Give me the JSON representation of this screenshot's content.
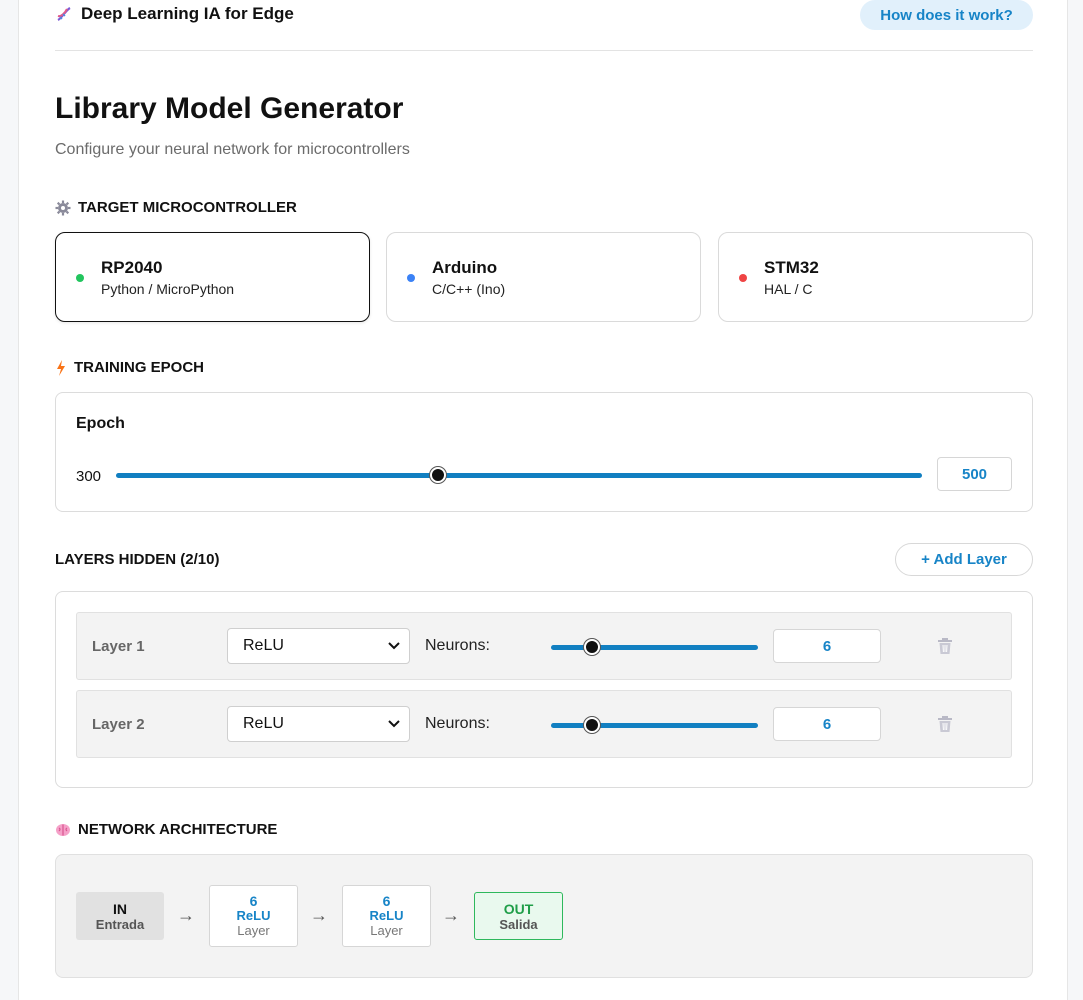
{
  "header": {
    "brand_title": "Deep Learning IA for Edge",
    "brand_icon": "dna-icon",
    "help_button": "How does it work?"
  },
  "main": {
    "title": "Library Model Generator",
    "subtitle": "Configure your neural network for microcontrollers"
  },
  "target": {
    "section_label": "TARGET MICROCONTROLLER",
    "section_icon": "gear-icon",
    "options": [
      {
        "name": "RP2040",
        "lang": "Python / MicroPython",
        "color": "#22c55e",
        "selected": true
      },
      {
        "name": "Arduino",
        "lang": "C/C++ (Ino)",
        "color": "#3b82f6",
        "selected": false
      },
      {
        "name": "STM32",
        "lang": "HAL / C",
        "color": "#ef4444",
        "selected": false
      }
    ]
  },
  "training": {
    "section_label": "TRAINING EPOCH",
    "section_icon": "lightning-icon",
    "epoch_label": "Epoch",
    "min_value": "300",
    "current_value": "500",
    "slider_fraction": 0.4
  },
  "layers": {
    "section_label": "LAYERS HIDDEN (2/10)",
    "add_button": "+ Add Layer",
    "neurons_label": "Neurons:",
    "items": [
      {
        "name": "Layer 1",
        "activation": "ReLU",
        "neurons": "6",
        "slider_fraction": 0.2
      },
      {
        "name": "Layer 2",
        "activation": "ReLU",
        "neurons": "6",
        "slider_fraction": 0.2
      }
    ]
  },
  "architecture": {
    "section_label": "NETWORK ARCHITECTURE",
    "section_icon": "brain-icon",
    "input": {
      "title": "IN",
      "sub": "Entrada"
    },
    "hidden": [
      {
        "neurons": "6",
        "activation": "ReLU",
        "sub": "Layer"
      },
      {
        "neurons": "6",
        "activation": "ReLU",
        "sub": "Layer"
      }
    ],
    "output": {
      "title": "OUT",
      "sub": "Salida"
    },
    "arrow": "→"
  }
}
